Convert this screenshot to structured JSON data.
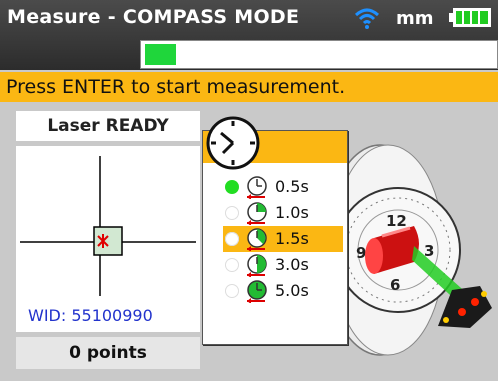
{
  "header": {
    "title": "Measure - COMPASS MODE",
    "units": "mm",
    "wifi_icon": "wifi-icon",
    "battery_icon": "battery-icon",
    "progress_fraction": 0.09
  },
  "banner": {
    "text": "Press ENTER to start measurement."
  },
  "laser": {
    "status": "Laser READY"
  },
  "detector": {
    "wid": "WID: 55100990"
  },
  "points": {
    "label": "0 points"
  },
  "popup": {
    "icon": "clock-icon",
    "options": [
      {
        "label": "0.5s",
        "active": true,
        "highlighted": false
      },
      {
        "label": "1.0s",
        "active": false,
        "highlighted": false
      },
      {
        "label": "1.5s",
        "active": false,
        "highlighted": true
      },
      {
        "label": "3.0s",
        "active": false,
        "highlighted": false
      },
      {
        "label": "5.0s",
        "active": false,
        "highlighted": false
      }
    ]
  },
  "compass": {
    "dial_numbers": [
      "12",
      "3",
      "6",
      "9"
    ]
  },
  "colors": {
    "accent": "#fbb713",
    "progress": "#1fd63b",
    "wid_text": "#2233cc",
    "active_radio": "#22dd22"
  }
}
